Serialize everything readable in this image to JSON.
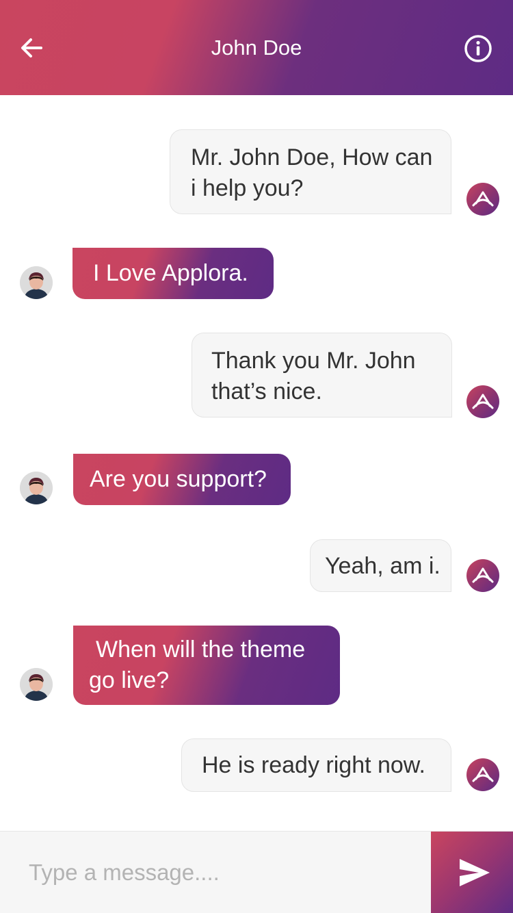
{
  "header": {
    "title": "John Doe",
    "back_icon": "arrow-left-icon",
    "info_icon": "info-circle-icon"
  },
  "messages": [
    {
      "from": "agent",
      "lines": [
        "Mr. John Doe, How can",
        "i help you?"
      ]
    },
    {
      "from": "user",
      "lines": [
        "I Love Applora."
      ]
    },
    {
      "from": "agent",
      "lines": [
        "Thank you Mr. John",
        "that’s nice."
      ]
    },
    {
      "from": "user",
      "lines": [
        "Are you support?"
      ]
    },
    {
      "from": "agent",
      "lines": [
        "Yeah, am i."
      ]
    },
    {
      "from": "user",
      "lines": [
        "When will the theme",
        "go live?"
      ]
    },
    {
      "from": "agent",
      "lines": [
        "He is ready right now."
      ]
    }
  ],
  "composer": {
    "placeholder": "Type a message....",
    "value": "",
    "send_icon": "send-icon"
  },
  "colors": {
    "gradient_start": "#c9455f",
    "gradient_end": "#5e2b84",
    "agent_bubble": "#f6f6f6",
    "agent_text": "#333333",
    "user_text": "#ffffff"
  }
}
